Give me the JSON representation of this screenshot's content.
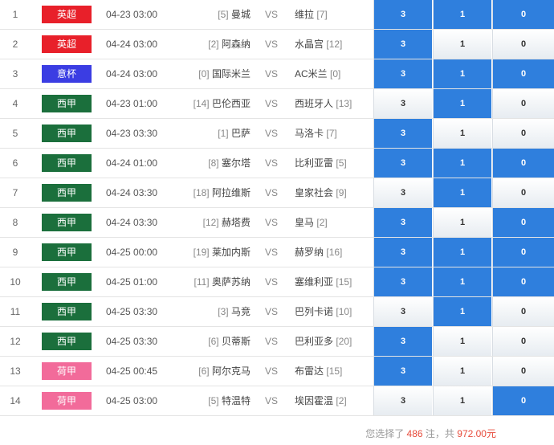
{
  "colors": {
    "selected_odd": "#2f7fdd",
    "league_epl": "#e8202a",
    "league_seriea": "#3b3de3",
    "league_laliga": "#1b6f3c",
    "league_eredivisie": "#f26b9a",
    "highlight_text": "#e74b3b"
  },
  "matches": [
    {
      "index": "1",
      "league": "英超",
      "league_color": "#e8202a",
      "time": "04-23 03:00",
      "home_rank": "[5]",
      "home": "曼城",
      "vs": "VS",
      "away": "维拉",
      "away_rank": "[7]",
      "odds": [
        {
          "label": "3",
          "selected": true
        },
        {
          "label": "1",
          "selected": true
        },
        {
          "label": "0",
          "selected": true
        }
      ]
    },
    {
      "index": "2",
      "league": "英超",
      "league_color": "#e8202a",
      "time": "04-24 03:00",
      "home_rank": "[2]",
      "home": "阿森纳",
      "vs": "VS",
      "away": "水晶宫",
      "away_rank": "[12]",
      "odds": [
        {
          "label": "3",
          "selected": true
        },
        {
          "label": "1",
          "selected": false
        },
        {
          "label": "0",
          "selected": false
        }
      ]
    },
    {
      "index": "3",
      "league": "意杯",
      "league_color": "#3b3de3",
      "time": "04-24 03:00",
      "home_rank": "[0]",
      "home": "国际米兰",
      "vs": "VS",
      "away": "AC米兰",
      "away_rank": "[0]",
      "odds": [
        {
          "label": "3",
          "selected": true
        },
        {
          "label": "1",
          "selected": true
        },
        {
          "label": "0",
          "selected": true
        }
      ]
    },
    {
      "index": "4",
      "league": "西甲",
      "league_color": "#1b6f3c",
      "time": "04-23 01:00",
      "home_rank": "[14]",
      "home": "巴伦西亚",
      "vs": "VS",
      "away": "西班牙人",
      "away_rank": "[13]",
      "odds": [
        {
          "label": "3",
          "selected": false
        },
        {
          "label": "1",
          "selected": true
        },
        {
          "label": "0",
          "selected": false
        }
      ]
    },
    {
      "index": "5",
      "league": "西甲",
      "league_color": "#1b6f3c",
      "time": "04-23 03:30",
      "home_rank": "[1]",
      "home": "巴萨",
      "vs": "VS",
      "away": "马洛卡",
      "away_rank": "[7]",
      "odds": [
        {
          "label": "3",
          "selected": true
        },
        {
          "label": "1",
          "selected": false
        },
        {
          "label": "0",
          "selected": false
        }
      ]
    },
    {
      "index": "6",
      "league": "西甲",
      "league_color": "#1b6f3c",
      "time": "04-24 01:00",
      "home_rank": "[8]",
      "home": "塞尔塔",
      "vs": "VS",
      "away": "比利亚雷",
      "away_rank": "[5]",
      "odds": [
        {
          "label": "3",
          "selected": true
        },
        {
          "label": "1",
          "selected": true
        },
        {
          "label": "0",
          "selected": true
        }
      ]
    },
    {
      "index": "7",
      "league": "西甲",
      "league_color": "#1b6f3c",
      "time": "04-24 03:30",
      "home_rank": "[18]",
      "home": "阿拉维斯",
      "vs": "VS",
      "away": "皇家社会",
      "away_rank": "[9]",
      "odds": [
        {
          "label": "3",
          "selected": false
        },
        {
          "label": "1",
          "selected": true
        },
        {
          "label": "0",
          "selected": false
        }
      ]
    },
    {
      "index": "8",
      "league": "西甲",
      "league_color": "#1b6f3c",
      "time": "04-24 03:30",
      "home_rank": "[12]",
      "home": "赫塔费",
      "vs": "VS",
      "away": "皇马",
      "away_rank": "[2]",
      "odds": [
        {
          "label": "3",
          "selected": true
        },
        {
          "label": "1",
          "selected": false
        },
        {
          "label": "0",
          "selected": true
        }
      ]
    },
    {
      "index": "9",
      "league": "西甲",
      "league_color": "#1b6f3c",
      "time": "04-25 00:00",
      "home_rank": "[19]",
      "home": "莱加内斯",
      "vs": "VS",
      "away": "赫罗纳",
      "away_rank": "[16]",
      "odds": [
        {
          "label": "3",
          "selected": true
        },
        {
          "label": "1",
          "selected": true
        },
        {
          "label": "0",
          "selected": true
        }
      ]
    },
    {
      "index": "10",
      "league": "西甲",
      "league_color": "#1b6f3c",
      "time": "04-25 01:00",
      "home_rank": "[11]",
      "home": "奥萨苏纳",
      "vs": "VS",
      "away": "塞维利亚",
      "away_rank": "[15]",
      "odds": [
        {
          "label": "3",
          "selected": true
        },
        {
          "label": "1",
          "selected": true
        },
        {
          "label": "0",
          "selected": true
        }
      ]
    },
    {
      "index": "11",
      "league": "西甲",
      "league_color": "#1b6f3c",
      "time": "04-25 03:30",
      "home_rank": "[3]",
      "home": "马竞",
      "vs": "VS",
      "away": "巴列卡诺",
      "away_rank": "[10]",
      "odds": [
        {
          "label": "3",
          "selected": false
        },
        {
          "label": "1",
          "selected": true
        },
        {
          "label": "0",
          "selected": false
        }
      ]
    },
    {
      "index": "12",
      "league": "西甲",
      "league_color": "#1b6f3c",
      "time": "04-25 03:30",
      "home_rank": "[6]",
      "home": "贝蒂斯",
      "vs": "VS",
      "away": "巴利亚多",
      "away_rank": "[20]",
      "odds": [
        {
          "label": "3",
          "selected": true
        },
        {
          "label": "1",
          "selected": false
        },
        {
          "label": "0",
          "selected": false
        }
      ]
    },
    {
      "index": "13",
      "league": "荷甲",
      "league_color": "#f26b9a",
      "time": "04-25 00:45",
      "home_rank": "[6]",
      "home": "阿尔克马",
      "vs": "VS",
      "away": "布雷达",
      "away_rank": "[15]",
      "odds": [
        {
          "label": "3",
          "selected": true
        },
        {
          "label": "1",
          "selected": false
        },
        {
          "label": "0",
          "selected": false
        }
      ]
    },
    {
      "index": "14",
      "league": "荷甲",
      "league_color": "#f26b9a",
      "time": "04-25 03:00",
      "home_rank": "[5]",
      "home": "特温特",
      "vs": "VS",
      "away": "埃因霍温",
      "away_rank": "[2]",
      "odds": [
        {
          "label": "3",
          "selected": false
        },
        {
          "label": "1",
          "selected": false
        },
        {
          "label": "0",
          "selected": true
        }
      ]
    }
  ],
  "summary": {
    "prefix": "您选择了",
    "count": "486",
    "mid": "注，共",
    "amount": "972.00元"
  }
}
